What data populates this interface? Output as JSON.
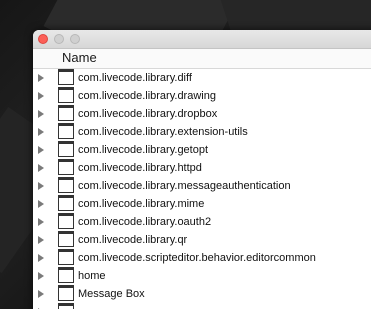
{
  "window": {
    "column_header": "Name"
  },
  "rows": [
    {
      "label": "com.livecode.library.diff",
      "icon": "stack-icon"
    },
    {
      "label": "com.livecode.library.drawing",
      "icon": "stack-icon"
    },
    {
      "label": "com.livecode.library.dropbox",
      "icon": "stack-icon"
    },
    {
      "label": "com.livecode.library.extension-utils",
      "icon": "stack-icon"
    },
    {
      "label": "com.livecode.library.getopt",
      "icon": "stack-icon"
    },
    {
      "label": "com.livecode.library.httpd",
      "icon": "stack-icon"
    },
    {
      "label": "com.livecode.library.messageauthentication",
      "icon": "stack-icon"
    },
    {
      "label": "com.livecode.library.mime",
      "icon": "stack-icon"
    },
    {
      "label": "com.livecode.library.oauth2",
      "icon": "stack-icon"
    },
    {
      "label": "com.livecode.library.qr",
      "icon": "stack-icon"
    },
    {
      "label": "com.livecode.scripteditor.behavior.editorcommon",
      "icon": "stack-icon"
    },
    {
      "label": "home",
      "icon": "stack-icon"
    },
    {
      "label": "Message Box",
      "icon": "stack-icon"
    },
    {
      "label": "",
      "icon": "stack-icon"
    }
  ],
  "colors": {
    "close_button": "#fc5f57",
    "disabled_button": "#d0d0d0"
  }
}
